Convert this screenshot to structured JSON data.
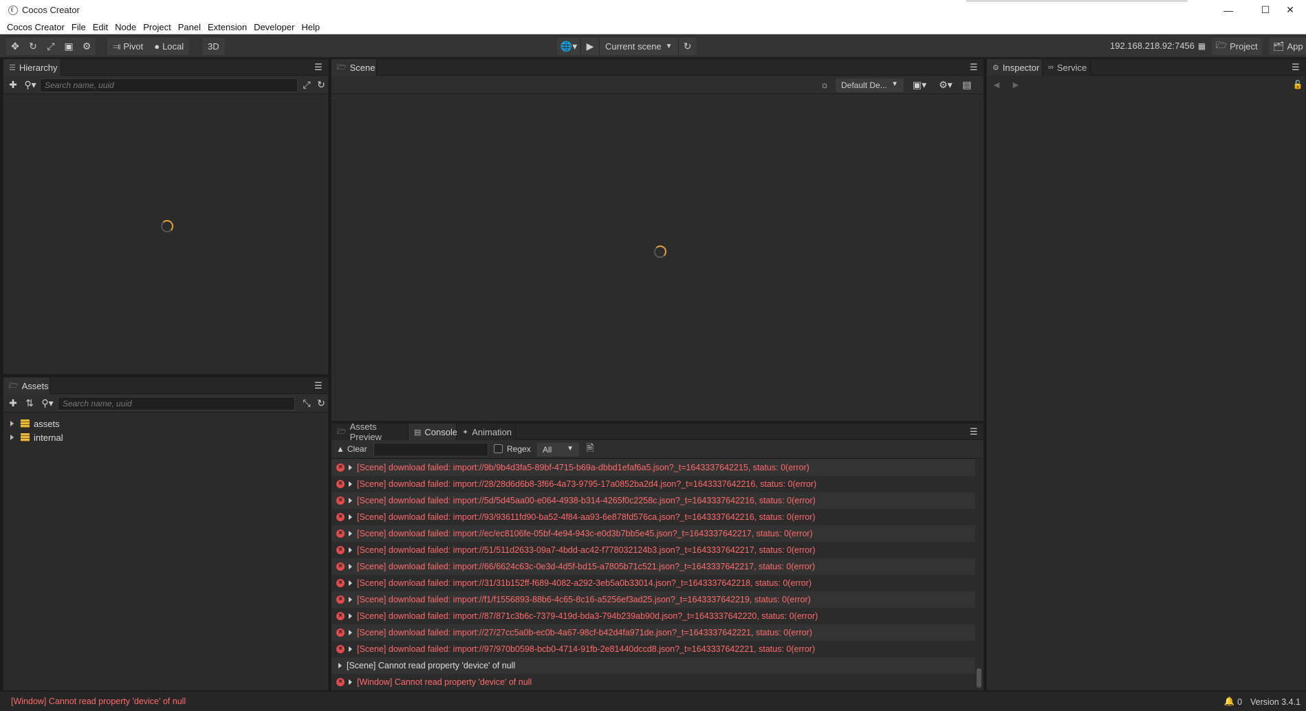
{
  "window": {
    "title": "Cocos Creator",
    "minimize_icon": "minimize-icon",
    "maximize_icon": "maximize-icon",
    "close_icon": "close-icon"
  },
  "menu": [
    "Cocos Creator",
    "File",
    "Edit",
    "Node",
    "Project",
    "Panel",
    "Extension",
    "Developer",
    "Help"
  ],
  "toolbar": {
    "pivot_label": "Pivot",
    "local_label": "Local",
    "mode_3d_label": "3D",
    "scene_select": "Current scene",
    "ip_address": "192.168.218.92:7456",
    "project_button": "Project",
    "app_button": "App"
  },
  "hierarchy": {
    "tab": "Hierarchy",
    "search_placeholder": "Search name, uuid"
  },
  "assets": {
    "tab": "Assets",
    "search_placeholder": "Search name, uuid",
    "tree": [
      "assets",
      "internal"
    ]
  },
  "scene": {
    "tab": "Scene",
    "camera_select": "Default De..."
  },
  "inspector": {
    "tabs": [
      "Inspector",
      "Service"
    ]
  },
  "bottom": {
    "tabs": [
      "Assets Preview",
      "Console",
      "Animation"
    ],
    "clear_label": "Clear",
    "regex_label": "Regex",
    "level_select": "All"
  },
  "console_logs": [
    {
      "type": "error",
      "text": "[Scene] download failed: import://9b/9b4d3fa5-89bf-4715-b69a-dbbd1efaf6a5.json?_t=1643337642215, status: 0(error)"
    },
    {
      "type": "error",
      "text": "[Scene] download failed: import://28/28d6d6b8-3f66-4a73-9795-17a0852ba2d4.json?_t=1643337642216, status: 0(error)"
    },
    {
      "type": "error",
      "text": "[Scene] download failed: import://5d/5d45aa00-e064-4938-b314-4265f0c2258c.json?_t=1643337642216, status: 0(error)"
    },
    {
      "type": "error",
      "text": "[Scene] download failed: import://93/93611fd90-ba52-4f84-aa93-6e878fd576ca.json?_t=1643337642216, status: 0(error)"
    },
    {
      "type": "error",
      "text": "[Scene] download failed: import://ec/ec8106fe-05bf-4e94-943c-e0d3b7bb5e45.json?_t=1643337642217, status: 0(error)"
    },
    {
      "type": "error",
      "text": "[Scene] download failed: import://51/511d2633-09a7-4bdd-ac42-f778032124b3.json?_t=1643337642217, status: 0(error)"
    },
    {
      "type": "error",
      "text": "[Scene] download failed: import://66/6624c63c-0e3d-4d5f-bd15-a7805b71c521.json?_t=1643337642217, status: 0(error)"
    },
    {
      "type": "error",
      "text": "[Scene] download failed: import://31/31b152ff-f689-4082-a292-3eb5a0b33014.json?_t=1643337642218, status: 0(error)"
    },
    {
      "type": "error",
      "text": "[Scene] download failed: import://f1/f1556893-88b6-4c65-8c16-a5256ef3ad25.json?_t=1643337642219, status: 0(error)"
    },
    {
      "type": "error",
      "text": "[Scene] download failed: import://87/871c3b6c-7379-419d-bda3-794b239ab90d.json?_t=1643337642220, status: 0(error)"
    },
    {
      "type": "error",
      "text": "[Scene] download failed: import://27/27cc5a0b-ec0b-4a67-98cf-b42d4fa971de.json?_t=1643337642221, status: 0(error)"
    },
    {
      "type": "error",
      "text": "[Scene] download failed: import://97/970b0598-bcb0-4714-91fb-2e81440dccd8.json?_t=1643337642221, status: 0(error)"
    },
    {
      "type": "info",
      "text": "[Scene] Cannot read property 'device' of null"
    },
    {
      "type": "error",
      "text": "[Window] Cannot read property 'device' of null"
    }
  ],
  "status": {
    "message": "[Window] Cannot read property 'device' of null",
    "notification_count": "0",
    "version": "Version 3.4.1"
  },
  "colors": {
    "error": "#ff6b6b",
    "spinner": "#e8a33a",
    "panel_bg": "#2b2b2b"
  }
}
